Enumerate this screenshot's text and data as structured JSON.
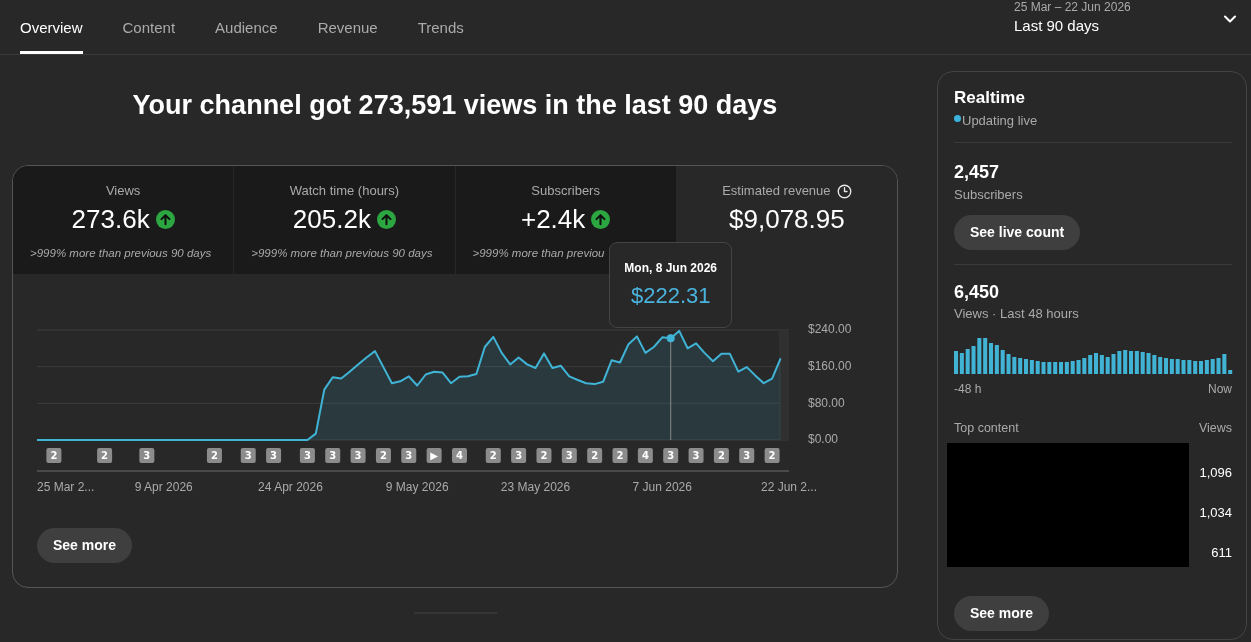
{
  "tabs": [
    {
      "label": "Overview",
      "selected": true
    },
    {
      "label": "Content",
      "selected": false
    },
    {
      "label": "Audience",
      "selected": false
    },
    {
      "label": "Revenue",
      "selected": false
    },
    {
      "label": "Trends",
      "selected": false
    }
  ],
  "date_range": {
    "range": "25 Mar – 22 Jun 2026",
    "period": "Last 90 days"
  },
  "headline": "Your channel got 273,591 views in the last 90 days",
  "metrics": [
    {
      "kind": "growth",
      "label": "Views",
      "value": "273.6k",
      "increased": true,
      "note": ">999% more than previous 90 days",
      "selected": false
    },
    {
      "kind": "growth",
      "label": "Watch time (hours)",
      "value": "205.2k",
      "increased": true,
      "note": ">999% more than previous 90 days",
      "selected": false
    },
    {
      "kind": "growth",
      "label": "Subscribers",
      "value": "+2.4k",
      "increased": true,
      "note": ">999% more than previou",
      "selected": false
    },
    {
      "kind": "estimate",
      "label": "Estimated revenue",
      "value": "$9,078.95",
      "selected": true
    }
  ],
  "chart": {
    "tooltip": {
      "date": "Mon, 8 Jun 2026",
      "value": "$222.31"
    },
    "upload_markers": [
      "2",
      "2",
      "3",
      "2",
      "3",
      "3",
      "3",
      "3",
      "3",
      "2",
      "3",
      "▶",
      "4",
      "2",
      "3",
      "2",
      "3",
      "2",
      "2",
      "4",
      "3",
      "3",
      "2",
      "3",
      "2"
    ],
    "chart_data": {
      "type": "area",
      "categories": [
        "25 Mar 2...",
        null,
        null,
        null,
        null,
        null,
        null,
        null,
        null,
        null,
        null,
        null,
        null,
        null,
        null,
        "9 Apr 2026",
        null,
        null,
        null,
        null,
        null,
        null,
        null,
        null,
        null,
        null,
        null,
        null,
        null,
        null,
        "24 Apr 2026",
        null,
        null,
        null,
        null,
        null,
        null,
        null,
        null,
        null,
        null,
        null,
        null,
        null,
        null,
        "9 May 2026",
        null,
        null,
        null,
        null,
        null,
        null,
        null,
        null,
        null,
        null,
        null,
        null,
        null,
        "23 May 2026",
        null,
        null,
        null,
        null,
        null,
        null,
        null,
        null,
        null,
        null,
        null,
        null,
        null,
        null,
        "7 Jun 2026",
        null,
        null,
        null,
        null,
        null,
        null,
        null,
        null,
        null,
        null,
        null,
        null,
        null,
        null,
        "22 Jun 2..."
      ],
      "series": [
        {
          "color": "#40b4d6",
          "values": [
            0,
            0,
            0,
            0,
            0,
            0,
            0,
            0,
            0,
            0,
            0,
            0,
            0,
            0,
            0,
            0,
            0,
            0,
            0,
            0,
            0,
            0,
            0,
            0,
            0,
            0,
            0,
            0,
            0,
            0,
            0,
            0,
            0,
            14,
            110,
            137,
            134,
            149,
            165,
            180,
            194,
            159,
            124,
            128,
            139,
            119,
            143,
            149,
            147,
            124,
            138,
            139,
            144,
            203,
            225,
            190,
            165,
            180,
            165,
            157,
            189,
            157,
            162,
            139,
            131,
            124,
            122,
            127,
            174,
            169,
            209,
            226,
            190,
            203,
            224,
            222,
            238,
            200,
            211,
            190,
            172,
            188,
            188,
            149,
            159,
            141,
            124,
            134,
            178,
            null
          ]
        }
      ],
      "ylim": [
        0,
        240
      ],
      "yticks": [
        {
          "value": 0,
          "label": "$0.00"
        },
        {
          "value": 80,
          "label": "$80.00"
        },
        {
          "value": 160,
          "label": "$160.00"
        },
        {
          "value": 240,
          "label": "$240.00"
        }
      ]
    }
  },
  "see_more_button": "See more",
  "realtime": {
    "title": "Realtime",
    "status": "Updating live",
    "subscribers": {
      "value": "2,457",
      "label": "Subscribers",
      "button": "See live count"
    },
    "views": {
      "value": "6,450",
      "label": "Views · Last 48 hours",
      "axis_start": "-48 h",
      "axis_end": "Now"
    },
    "top_content": {
      "columns": [
        "Top content",
        "Views"
      ],
      "rows": [
        {
          "views": "1,096"
        },
        {
          "views": "1,034"
        },
        {
          "views": "611"
        }
      ]
    },
    "button": "See more"
  }
}
